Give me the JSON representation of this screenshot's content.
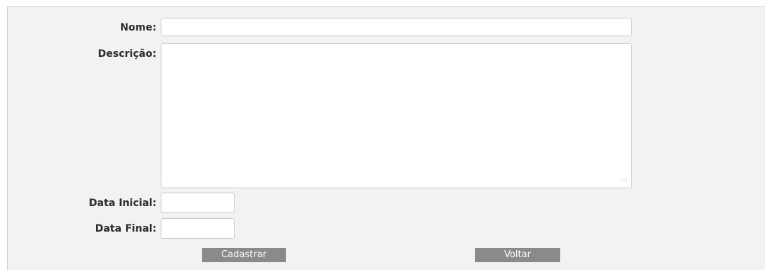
{
  "form": {
    "nome_label": "Nome:",
    "nome_value": "",
    "descricao_label": "Descrição:",
    "descricao_value": "",
    "data_inicial_label": "Data Inicial:",
    "data_inicial_value": "",
    "data_final_label": "Data Final:",
    "data_final_value": ""
  },
  "actions": {
    "cadastrar_label": "Cadastrar",
    "voltar_label": "Voltar"
  }
}
